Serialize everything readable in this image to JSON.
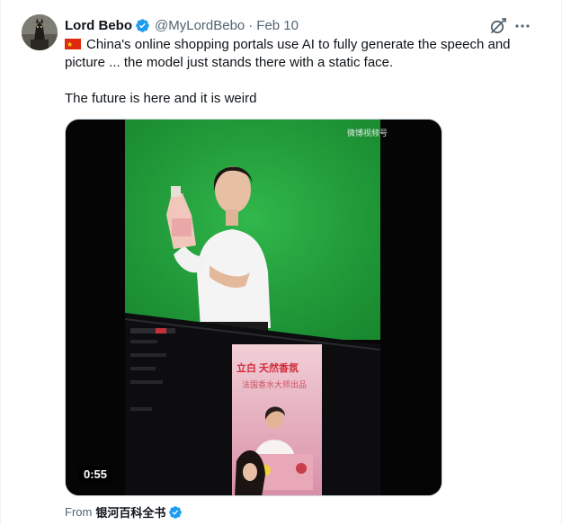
{
  "tweet": {
    "author_name": "Lord Bebo",
    "handle": "@MyLordBebo",
    "separator": "·",
    "date": "Feb 10",
    "paragraph1": "China's online shopping portals use AI to fully generate the speech and picture ... the model just stands there with a static face.",
    "paragraph2": "The future is here and it is weird"
  },
  "video": {
    "duration": "0:55",
    "watermark": "微博视频号"
  },
  "screen_text": {
    "line1": "立白  夭然香氛",
    "line2": "法国香水大师出品"
  },
  "attribution": {
    "prefix": "From",
    "source": "银河百科全书"
  },
  "colors": {
    "verified": "#1d9bf0",
    "secondary_text": "#536471",
    "greenscreen": "#1fa23a"
  },
  "icons": {
    "verified": "verified-badge-icon",
    "grok": "grok-icon",
    "more": "more-icon"
  }
}
